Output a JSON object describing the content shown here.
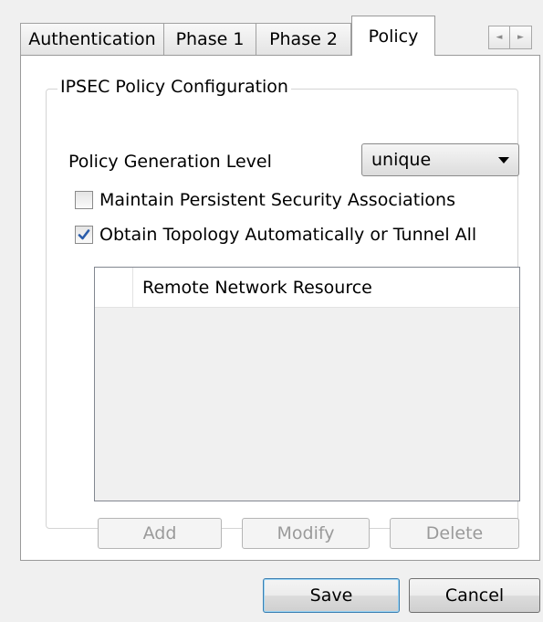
{
  "tabs": [
    {
      "label": "Authentication"
    },
    {
      "label": "Phase 1"
    },
    {
      "label": "Phase 2"
    },
    {
      "label": "Policy"
    }
  ],
  "scroll_arrows": {
    "left_icon": "◄",
    "right_icon": "►"
  },
  "policy": {
    "group_title": "IPSEC Policy Configuration",
    "generation_level_label": "Policy Generation Level",
    "generation_level_value": "unique",
    "persistent_sa_label": "Maintain Persistent Security Associations",
    "persistent_sa_checked": false,
    "topology_label": "Obtain Topology Automatically or Tunnel All",
    "topology_checked": true,
    "list_column": "Remote Network Resource",
    "add_label": "Add",
    "modify_label": "Modify",
    "delete_label": "Delete"
  },
  "footer": {
    "save_label": "Save",
    "cancel_label": "Cancel"
  },
  "colors": {
    "window_bg": "#f0f0f0",
    "check_mark": "#2a5caa",
    "disabled_text": "#9a9a9a"
  }
}
